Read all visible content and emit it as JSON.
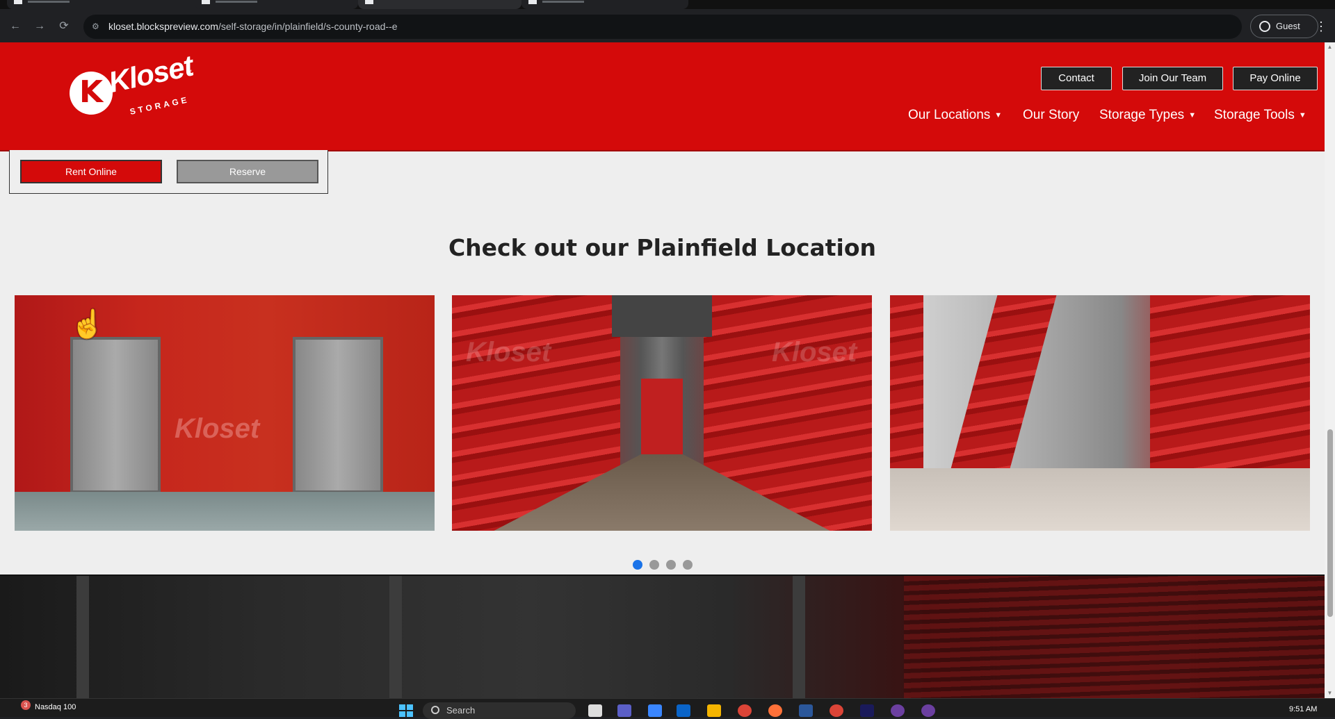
{
  "browser": {
    "url_host": "kloset.blockspreview.com",
    "url_path": "/self-storage/in/plainfield/s-county-road--e",
    "profile_label": "Guest",
    "back_icon": "arrow-left-icon",
    "forward_icon": "arrow-right-icon",
    "reload_icon": "reload-icon",
    "menu_icon": "more-vertical-icon"
  },
  "header": {
    "brand_name": "Kloset",
    "brand_sub": "STORAGE",
    "brand_tm": "™",
    "brand_color": "#d40a0a",
    "buttons": {
      "contact": "Contact",
      "join": "Join Our Team",
      "pay": "Pay Online"
    },
    "nav": {
      "locations": "Our Locations",
      "story": "Our Story",
      "types": "Storage Types",
      "tools": "Storage Tools"
    }
  },
  "rent_box": {
    "rent_label": "Rent Online",
    "reserve_label": "Reserve"
  },
  "gallery": {
    "title": "Check out our Plainfield Location",
    "slide_count": 4,
    "active_slide": 1
  },
  "taskbar": {
    "widget_label": "Nasdaq 100",
    "widget_badge": "3",
    "search_label": "Search",
    "clock": "9:51 AM"
  }
}
